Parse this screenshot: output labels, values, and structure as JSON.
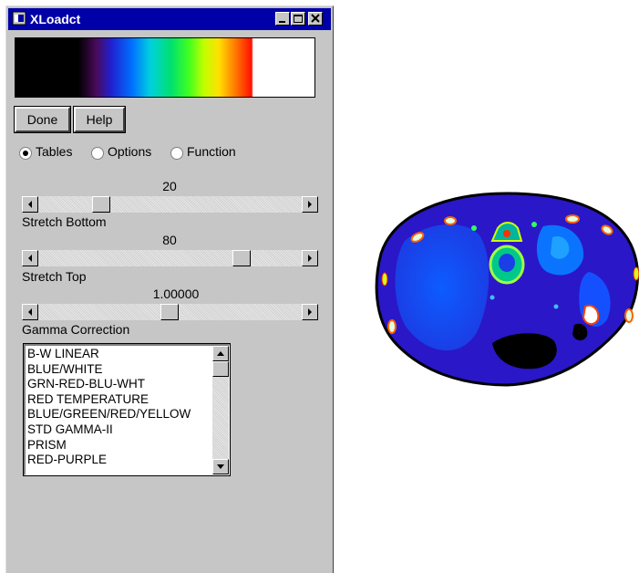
{
  "window": {
    "title": "XLoadct",
    "title_icon": "app-icon"
  },
  "title_buttons": {
    "minimize": "minimize-icon",
    "maximize": "maximize-icon",
    "close": "close-icon"
  },
  "buttons": {
    "done": "Done",
    "help": "Help"
  },
  "modes": [
    {
      "label": "Tables",
      "selected": true
    },
    {
      "label": "Options",
      "selected": false
    },
    {
      "label": "Function",
      "selected": false
    }
  ],
  "sliders": {
    "stretch_bottom": {
      "value": "20",
      "label": "Stretch Bottom"
    },
    "stretch_top": {
      "value": "80",
      "label": "Stretch Top"
    },
    "gamma": {
      "value": "1.00000",
      "label": "Gamma Correction"
    }
  },
  "color_tables": [
    "B-W LINEAR",
    "BLUE/WHITE",
    "GRN-RED-BLU-WHT",
    "RED TEMPERATURE",
    "BLUE/GREEN/RED/YELLOW",
    "STD GAMMA-II",
    "PRISM",
    "RED-PURPLE"
  ],
  "colors": {
    "title_bar": "#0000a8",
    "panel": "#c6c6c6",
    "image_background": "#2a17c8"
  }
}
